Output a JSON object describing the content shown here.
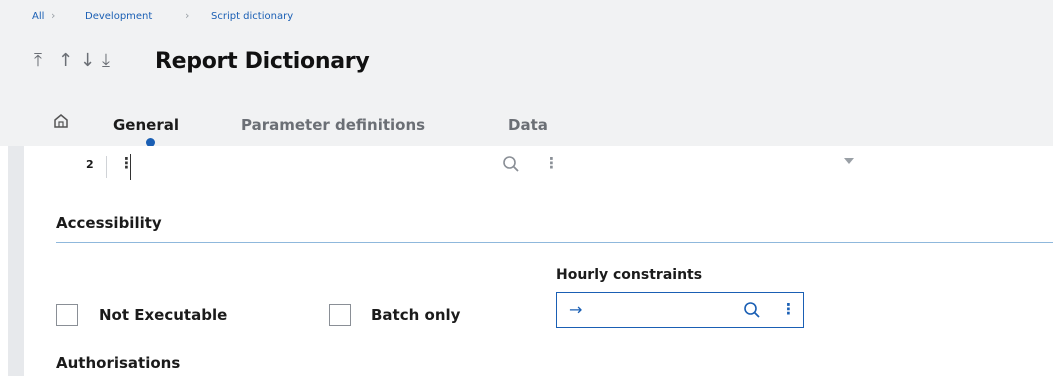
{
  "breadcrumb": {
    "items": [
      "All",
      "Development",
      "Script dictionary"
    ]
  },
  "header": {
    "nav_icons": [
      "first-record-icon",
      "previous-record-icon",
      "next-record-icon",
      "last-record-icon"
    ],
    "title": "Report Dictionary"
  },
  "tabs": [
    {
      "label": "General",
      "active": true
    },
    {
      "label": "Parameter definitions",
      "active": false
    },
    {
      "label": "Data",
      "active": false
    }
  ],
  "grid": {
    "row_number": "2"
  },
  "accessibility": {
    "title": "Accessibility",
    "not_executable_label": "Not Executable",
    "not_executable_checked": false,
    "batch_only_label": "Batch only",
    "batch_only_checked": false,
    "hourly_constraints_label": "Hourly constraints",
    "hourly_constraints_value": ""
  },
  "authorisations": {
    "title": "Authorisations"
  },
  "colors": {
    "accent": "#1a5fb4",
    "header_bg": "#f1f2f3",
    "section_line": "#8fb8dc"
  }
}
